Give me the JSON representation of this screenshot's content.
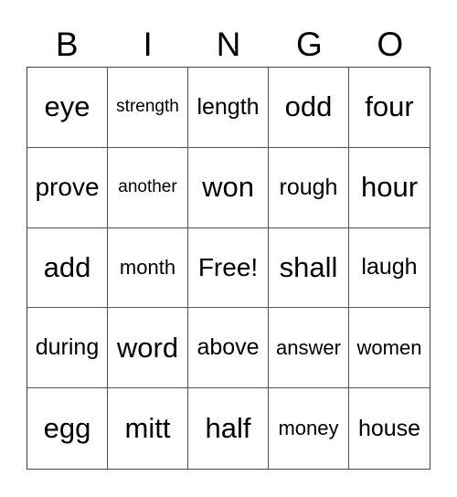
{
  "card": {
    "header": [
      "B",
      "I",
      "N",
      "G",
      "O"
    ],
    "rows": [
      [
        "eye",
        "strength",
        "length",
        "odd",
        "four"
      ],
      [
        "prove",
        "another",
        "won",
        "rough",
        "hour"
      ],
      [
        "add",
        "month",
        "Free!",
        "shall",
        "laugh"
      ],
      [
        "during",
        "word",
        "above",
        "answer",
        "women"
      ],
      [
        "egg",
        "mitt",
        "half",
        "money",
        "house"
      ]
    ],
    "free_space": "Free!"
  }
}
